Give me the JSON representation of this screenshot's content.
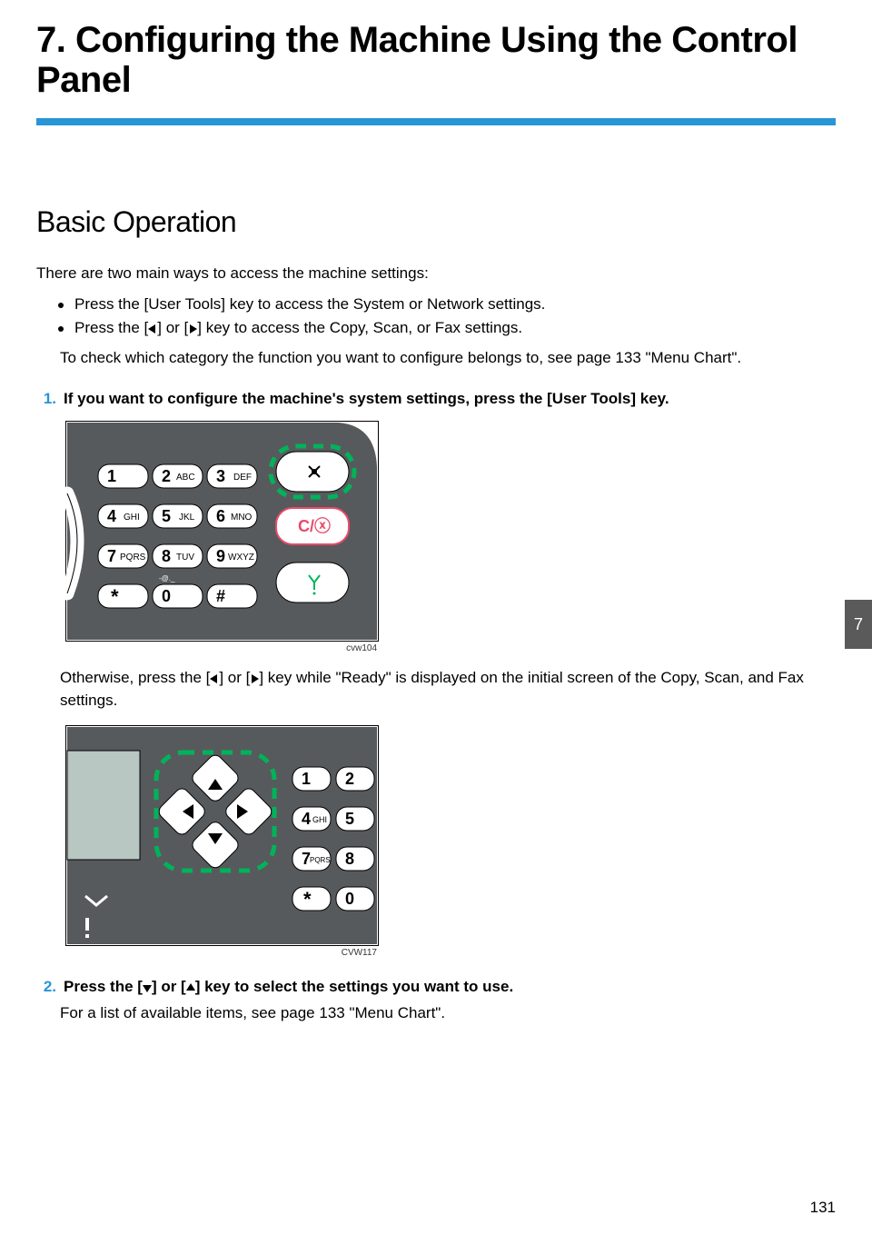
{
  "chapter": {
    "title": "7. Configuring the Machine Using the Control Panel",
    "tab_number": "7"
  },
  "section": {
    "title": "Basic Operation",
    "intro": "There are two main ways to access the machine settings:",
    "bullet1_pre": "Press the [User Tools] key to access the System or Network settings.",
    "bullet2_pre": "Press the [",
    "bullet2_mid": "] or [",
    "bullet2_post": "] key to access the Copy, Scan, or Fax settings.",
    "subnote": "To check which category the function you want to configure belongs to, see page 133 \"Menu Chart\".",
    "step1_num": "1.",
    "step1_text": "If you want to configure the machine's system settings, press the [User Tools] key.",
    "fig1_caption": "cvw104",
    "step1_after_pre": "Otherwise, press the [",
    "step1_after_mid": "] or [",
    "step1_after_post": "] key while \"Ready\" is displayed on the initial screen of the Copy, Scan, and Fax settings.",
    "fig2_caption": "CVW117",
    "step2_num": "2.",
    "step2_pre": "Press the [",
    "step2_mid": "] or [",
    "step2_post": "] key to select the settings you want to use.",
    "step2_after": "For a list of available items, see page 133 \"Menu Chart\"."
  },
  "keypad": {
    "keys": [
      {
        "n": "1",
        "l": ""
      },
      {
        "n": "2",
        "l": "ABC"
      },
      {
        "n": "3",
        "l": "DEF"
      },
      {
        "n": "4",
        "l": "GHI"
      },
      {
        "n": "5",
        "l": "JKL"
      },
      {
        "n": "6",
        "l": "MNO"
      },
      {
        "n": "7",
        "l": "PQRS"
      },
      {
        "n": "8",
        "l": "TUV"
      },
      {
        "n": "9",
        "l": "WXYZ"
      },
      {
        "n": "*",
        "l": ""
      },
      {
        "n": "0",
        "l": "-@._"
      },
      {
        "n": "#",
        "l": ""
      }
    ],
    "cancel_label": "C/ⓧ"
  },
  "page_number": "131"
}
